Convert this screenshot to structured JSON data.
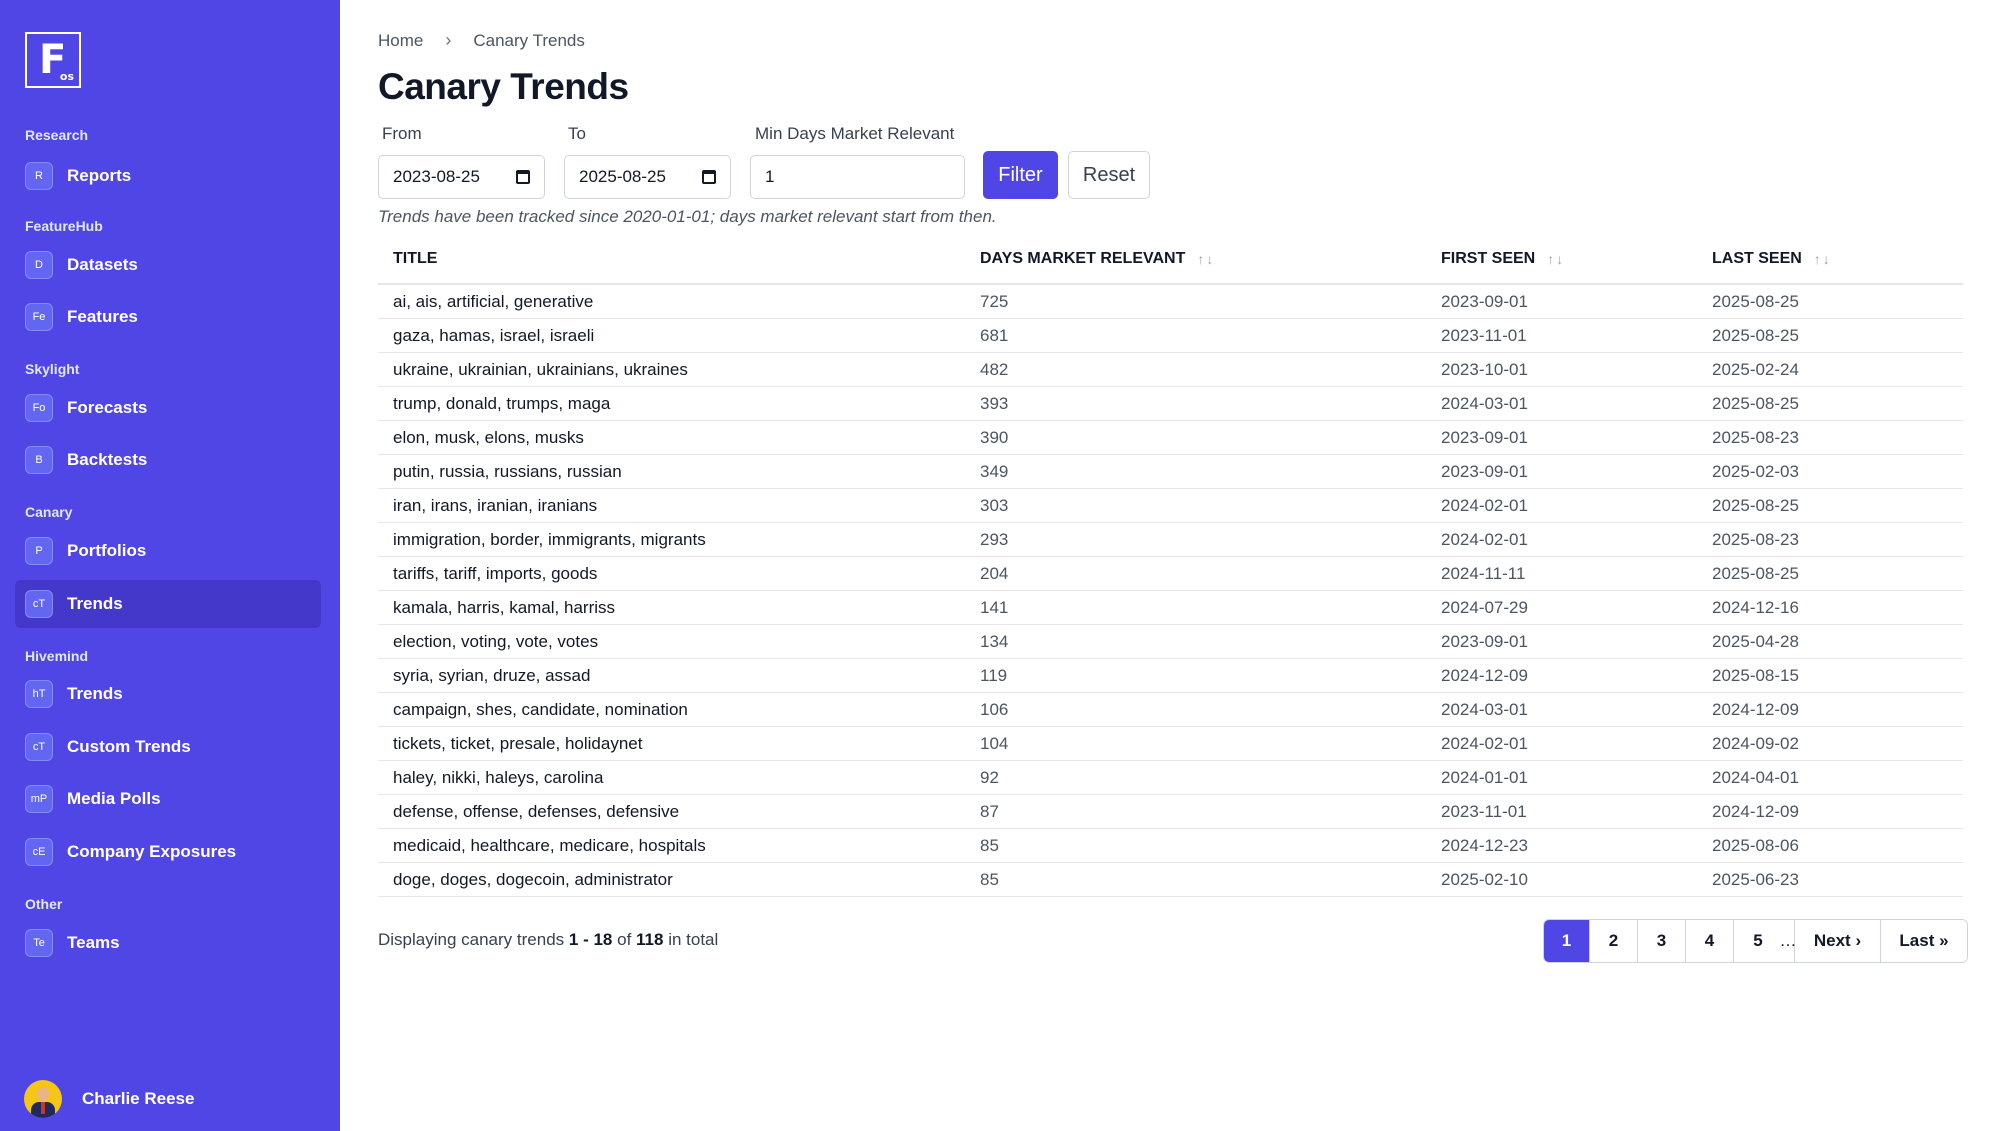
{
  "logo": {
    "letter": "F",
    "sub": "os"
  },
  "sidebar": {
    "sections": [
      {
        "label": "Research",
        "items": [
          {
            "badge": "R",
            "label": "Reports"
          }
        ]
      },
      {
        "label": "FeatureHub",
        "items": [
          {
            "badge": "D",
            "label": "Datasets"
          },
          {
            "badge": "Fe",
            "label": "Features"
          }
        ]
      },
      {
        "label": "Skylight",
        "items": [
          {
            "badge": "Fo",
            "label": "Forecasts"
          },
          {
            "badge": "B",
            "label": "Backtests"
          }
        ]
      },
      {
        "label": "Canary",
        "items": [
          {
            "badge": "P",
            "label": "Portfolios"
          },
          {
            "badge": "cT",
            "label": "Trends",
            "active": true
          }
        ]
      },
      {
        "label": "Hivemind",
        "items": [
          {
            "badge": "hT",
            "label": "Trends"
          },
          {
            "badge": "cT",
            "label": "Custom Trends"
          },
          {
            "badge": "mP",
            "label": "Media Polls"
          },
          {
            "badge": "cE",
            "label": "Company Exposures"
          }
        ]
      },
      {
        "label": "Other",
        "items": [
          {
            "badge": "Te",
            "label": "Teams"
          }
        ]
      }
    ],
    "user": {
      "name": "Charlie Reese"
    }
  },
  "breadcrumb": {
    "home": "Home",
    "separator": "›",
    "current": "Canary Trends"
  },
  "page": {
    "title": "Canary Trends"
  },
  "filters": {
    "from_label": "From",
    "from_value": "2023-08-25",
    "to_label": "To",
    "to_value": "2025-08-25",
    "min_label": "Min Days Market Relevant",
    "min_value": "1",
    "filter_button": "Filter",
    "reset_button": "Reset"
  },
  "note": "Trends have been tracked since 2020-01-01; days market relevant start from then.",
  "table": {
    "headers": {
      "title": "TITLE",
      "days": "DAYS MARKET RELEVANT",
      "first": "FIRST SEEN",
      "last": "LAST SEEN"
    },
    "sort_glyph": "↑↓",
    "rows": [
      {
        "title": "ai, ais, artificial, generative",
        "days": "725",
        "first": "2023-09-01",
        "last": "2025-08-25"
      },
      {
        "title": "gaza, hamas, israel, israeli",
        "days": "681",
        "first": "2023-11-01",
        "last": "2025-08-25"
      },
      {
        "title": "ukraine, ukrainian, ukrainians, ukraines",
        "days": "482",
        "first": "2023-10-01",
        "last": "2025-02-24"
      },
      {
        "title": "trump, donald, trumps, maga",
        "days": "393",
        "first": "2024-03-01",
        "last": "2025-08-25"
      },
      {
        "title": "elon, musk, elons, musks",
        "days": "390",
        "first": "2023-09-01",
        "last": "2025-08-23"
      },
      {
        "title": "putin, russia, russians, russian",
        "days": "349",
        "first": "2023-09-01",
        "last": "2025-02-03"
      },
      {
        "title": "iran, irans, iranian, iranians",
        "days": "303",
        "first": "2024-02-01",
        "last": "2025-08-25"
      },
      {
        "title": "immigration, border, immigrants, migrants",
        "days": "293",
        "first": "2024-02-01",
        "last": "2025-08-23"
      },
      {
        "title": "tariffs, tariff, imports, goods",
        "days": "204",
        "first": "2024-11-11",
        "last": "2025-08-25"
      },
      {
        "title": "kamala, harris, kamal, harriss",
        "days": "141",
        "first": "2024-07-29",
        "last": "2024-12-16"
      },
      {
        "title": "election, voting, vote, votes",
        "days": "134",
        "first": "2023-09-01",
        "last": "2025-04-28"
      },
      {
        "title": "syria, syrian, druze, assad",
        "days": "119",
        "first": "2024-12-09",
        "last": "2025-08-15"
      },
      {
        "title": "campaign, shes, candidate, nomination",
        "days": "106",
        "first": "2024-03-01",
        "last": "2024-12-09"
      },
      {
        "title": "tickets, ticket, presale, holidaynet",
        "days": "104",
        "first": "2024-02-01",
        "last": "2024-09-02"
      },
      {
        "title": "haley, nikki, haleys, carolina",
        "days": "92",
        "first": "2024-01-01",
        "last": "2024-04-01"
      },
      {
        "title": "defense, offense, defenses, defensive",
        "days": "87",
        "first": "2023-11-01",
        "last": "2024-12-09"
      },
      {
        "title": "medicaid, healthcare, medicare, hospitals",
        "days": "85",
        "first": "2024-12-23",
        "last": "2025-08-06"
      },
      {
        "title": "doge, doges, dogecoin, administrator",
        "days": "85",
        "first": "2025-02-10",
        "last": "2025-06-23"
      }
    ]
  },
  "summary": {
    "prefix": "Displaying canary trends",
    "range": "1 - 18",
    "of": "of",
    "total": "118",
    "suffix": "in total"
  },
  "pagination": {
    "pages": [
      {
        "label": "1",
        "current": true
      },
      {
        "label": "2"
      },
      {
        "label": "3"
      },
      {
        "label": "4"
      },
      {
        "label": "5"
      }
    ],
    "ellipsis": "…",
    "next": "Next ›",
    "last": "Last »"
  },
  "colors": {
    "sidebar": "#5046e5",
    "accent": "#4f46e5",
    "active_item": "#4338ca"
  }
}
